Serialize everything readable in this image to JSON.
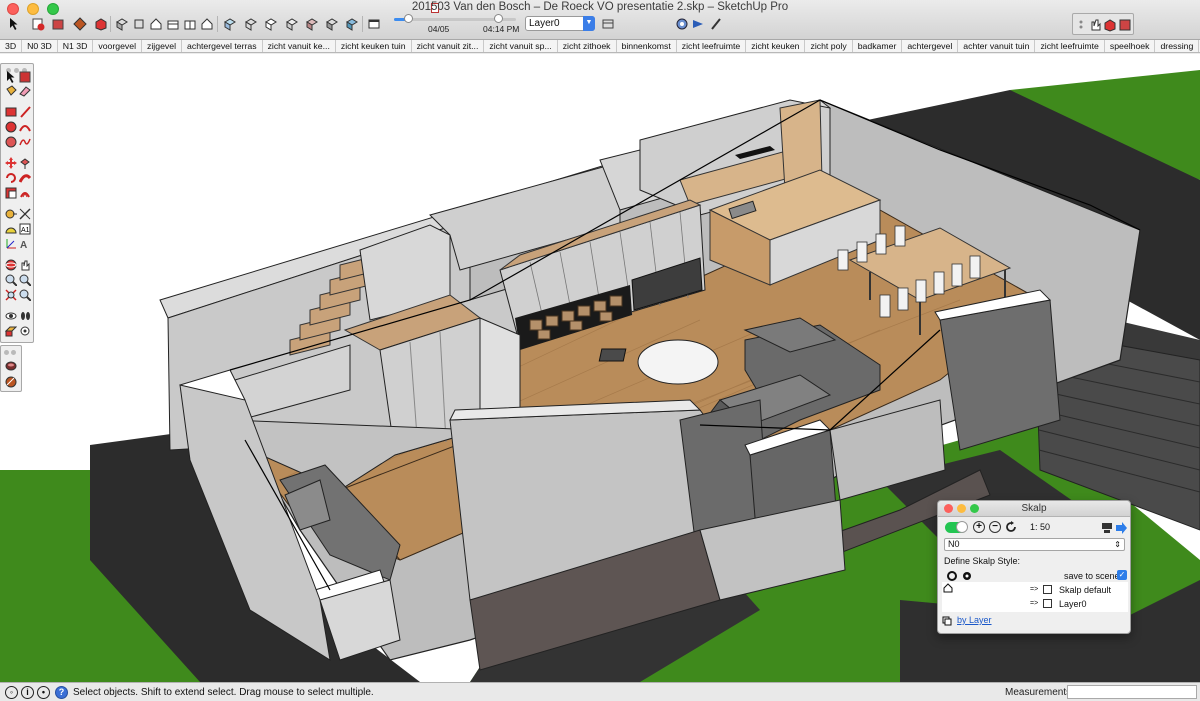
{
  "window": {
    "title": "201503 Van den Bosch – De Roeck VO presentatie 2.skp – SketchUp Pro"
  },
  "toolbar": {
    "shadow_date": "04/05",
    "shadow_time": "04:14 PM",
    "layer_value": "Layer0"
  },
  "scenes": [
    "3D",
    "N0 3D",
    "N1 3D",
    "voorgevel",
    "zijgevel",
    "achtergevel terras",
    "zicht vanuit ke...",
    "zicht keuken tuin",
    "zicht vanuit zit...",
    "zicht vanuit sp...",
    "zicht zithoek",
    "binnenkomst",
    "zicht leefruimte",
    "zicht keuken",
    "zicht poly",
    "badkamer",
    "achtergevel",
    "achter vanuit tuin",
    "zicht leefruimte",
    "speelhoek",
    "dressing"
  ],
  "skalp": {
    "title": "Skalp",
    "scale": "1: 50",
    "section_value": "N0",
    "define_label": "Define Skalp Style:",
    "save_label": "save to scene",
    "rows": [
      {
        "arrow": "=>",
        "label": "Skalp default"
      },
      {
        "arrow": "=>",
        "label": "Layer0"
      }
    ],
    "by_layer": "by Layer"
  },
  "status": {
    "text": "Select objects. Shift to extend select. Drag mouse to select multiple.",
    "measurements_label": "Measurements",
    "measurements_value": ""
  },
  "colors": {
    "grass": "#3f8a1c",
    "road": "#2c2c2c",
    "wood_floor": "#b98c5a",
    "wall_grey": "#c7c7c7",
    "brick": "#6b6b6b",
    "accent_blue": "#3b7ee8"
  }
}
